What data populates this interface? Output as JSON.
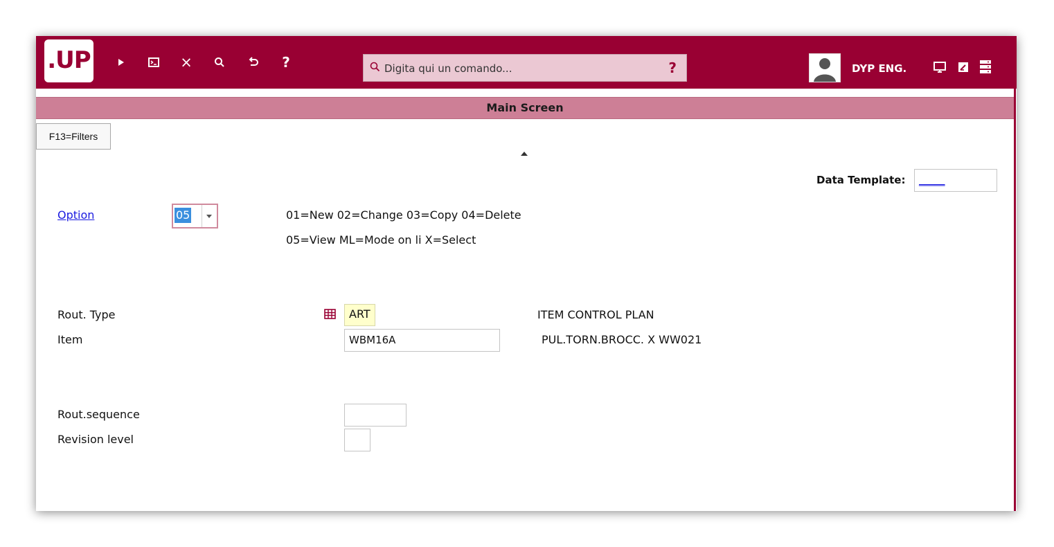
{
  "logo": {
    "text": ".UP"
  },
  "toolbar": {
    "icons": [
      "play-icon",
      "terminal-icon",
      "close-icon",
      "search-icon",
      "undo-icon",
      "help-icon"
    ],
    "close_glyph": "×",
    "help_glyph": "?"
  },
  "command": {
    "placeholder": "Digita qui un comando...",
    "help": "?"
  },
  "user": {
    "name": "DYP ENG."
  },
  "header_icons": [
    "monitor-icon",
    "edit-icon",
    "server-icon"
  ],
  "title": "Main Screen",
  "filters_button": "F13=Filters",
  "data_template": {
    "label": "Data Template:",
    "value": "_____"
  },
  "option": {
    "label": "Option",
    "value": "05",
    "help_line1": "01=New 02=Change 03=Copy 04=Delete",
    "help_line2": "05=View ML=Mode on li X=Select"
  },
  "rout_type": {
    "label": "Rout. Type",
    "value": "ART",
    "description": "ITEM CONTROL PLAN"
  },
  "item": {
    "label": "Item",
    "value": "WBM16A",
    "description": "PUL.TORN.BROCC.  X WW021"
  },
  "rout_sequence": {
    "label": "Rout.sequence",
    "value": ""
  },
  "revision_level": {
    "label": "Revision level",
    "value": ""
  },
  "colors": {
    "brand": "#990033",
    "title_bar": "#cd7f96",
    "search_bg": "#ebc8d3",
    "link": "#1a1ae0",
    "highlight": "#ffffcc"
  }
}
